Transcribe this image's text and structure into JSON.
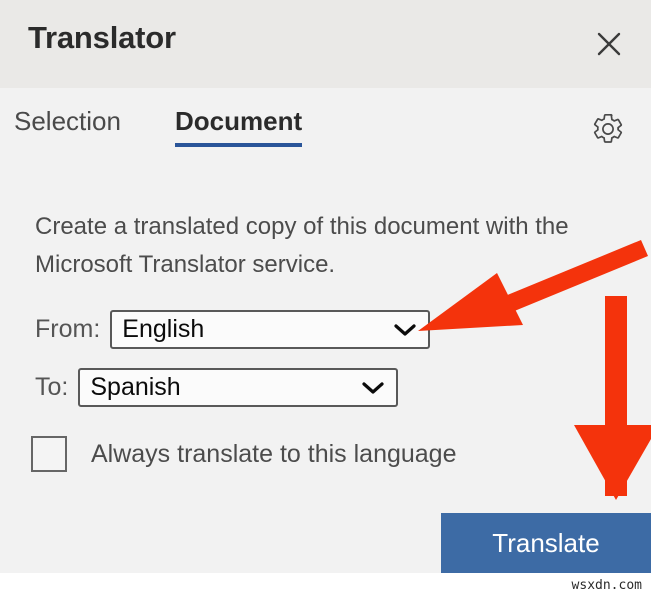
{
  "window": {
    "title": "Translator",
    "close_icon": "close-icon",
    "background": "#eae9e7"
  },
  "tabs": {
    "items": [
      {
        "label": "Selection",
        "selected": false
      },
      {
        "label": "Document",
        "selected": true
      }
    ],
    "settings_icon": "gear-icon",
    "accent_color": "#2a5599"
  },
  "main": {
    "description": "Create a translated copy of this document with the Microsoft Translator service.",
    "from": {
      "label": "From:",
      "value": "English",
      "caret_icon": "chevron-down-icon"
    },
    "to": {
      "label": "To:",
      "value": "Spanish",
      "caret_icon": "chevron-down-icon"
    },
    "always_translate": {
      "label": "Always translate to this language",
      "checked": false
    },
    "translate_button": {
      "label": "Translate",
      "color": "#3d6ba5"
    }
  },
  "annotations": {
    "arrow_color": "#f4330c",
    "arrows": [
      {
        "name": "arrow-to-from-dropdown",
        "direction": "down-left"
      },
      {
        "name": "arrow-to-translate-button",
        "direction": "down"
      }
    ]
  },
  "watermark": {
    "text": "wsxdn.com"
  }
}
